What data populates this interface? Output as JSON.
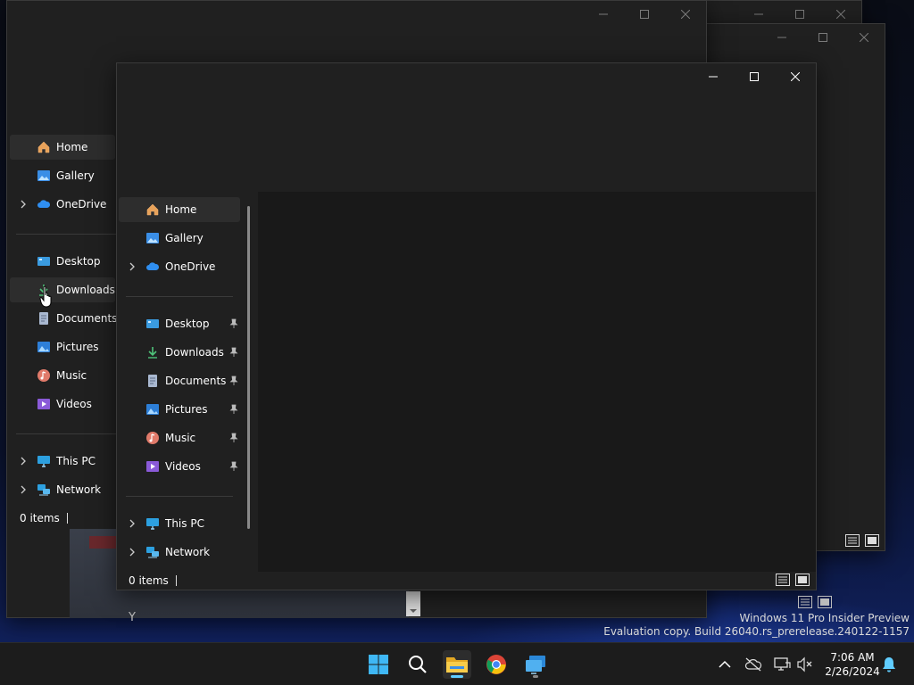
{
  "nav": {
    "home": "Home",
    "gallery": "Gallery",
    "onedrive": "OneDrive",
    "desktop": "Desktop",
    "downloads": "Downloads",
    "documents": "Documents",
    "pictures": "Pictures",
    "music": "Music",
    "videos": "Videos",
    "this_pc": "This PC",
    "network": "Network"
  },
  "status": {
    "items": "0 items"
  },
  "watermark": {
    "line1": "Windows 11 Pro Insider Preview",
    "line2": "Evaluation copy. Build 26040.rs_prerelease.240122-1157"
  },
  "clock": {
    "time": "7:06 AM",
    "date": "2/26/2024"
  },
  "background_text": {
    "line": "Y"
  },
  "colors": {
    "window_bg": "#202020",
    "selected_bg": "#2d2d2d",
    "taskbar_bg": "#1c1c1c",
    "accent": "#60cdff"
  },
  "icons": {
    "home": "home-icon",
    "gallery": "gallery-icon",
    "onedrive": "cloud-icon",
    "desktop": "desktop-icon",
    "downloads": "download-arrow-icon",
    "documents": "document-icon",
    "pictures": "picture-icon",
    "music": "music-icon",
    "videos": "video-icon",
    "this_pc": "monitor-icon",
    "network": "network-icon"
  }
}
